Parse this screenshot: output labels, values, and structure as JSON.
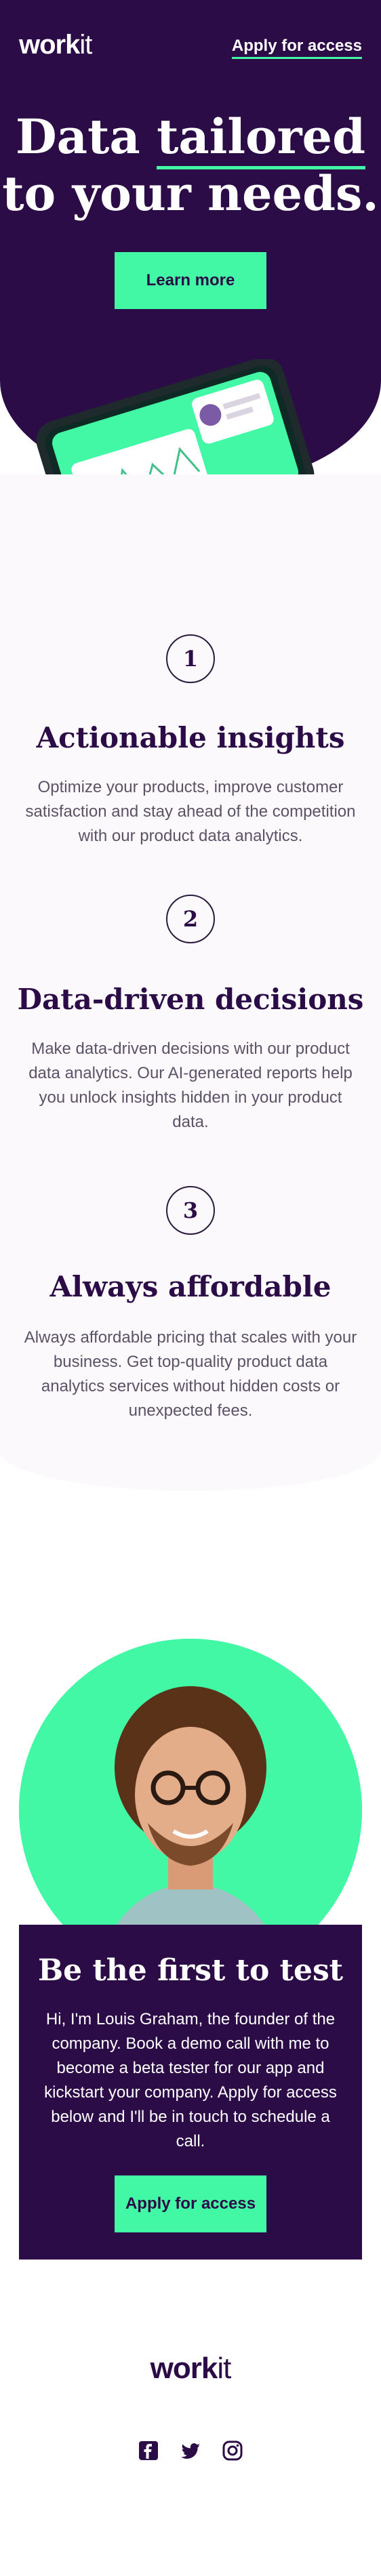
{
  "brand": {
    "logo_main": "work",
    "logo_accent": "it"
  },
  "header": {
    "apply_link": "Apply for access"
  },
  "hero": {
    "title_line1_a": "Data ",
    "title_line1_b": "tailored",
    "title_line2": "to your needs.",
    "button": "Learn more"
  },
  "features": [
    {
      "number": "1",
      "title": "Actionable insights",
      "text": "Optimize your products, improve customer satisfaction and stay ahead of the competition with our product data analytics."
    },
    {
      "number": "2",
      "title": "Data-driven decisions",
      "text": "Make data-driven decisions with our product data analytics. Our AI-generated reports help you unlock insights hidden in your product data."
    },
    {
      "number": "3",
      "title": "Always affordable",
      "text": "Always affordable pricing that scales with your business. Get top-quality product data analytics services without hidden costs or unexpected fees."
    }
  ],
  "cta": {
    "title": "Be the first to test",
    "text": "Hi, I'm Louis Graham, the founder of the company. Book a demo call with me to become a beta tester for our app and kickstart your company. Apply for access below and I'll be in touch to schedule a call.",
    "button": "Apply for access"
  },
  "footer": {
    "logo_main": "work",
    "logo_accent": "it",
    "socials": [
      "facebook-icon",
      "twitter-icon",
      "instagram-icon"
    ]
  },
  "colors": {
    "primary": "#2c0c47",
    "accent": "#43f8a5",
    "light_bg": "#fbf9fc"
  }
}
